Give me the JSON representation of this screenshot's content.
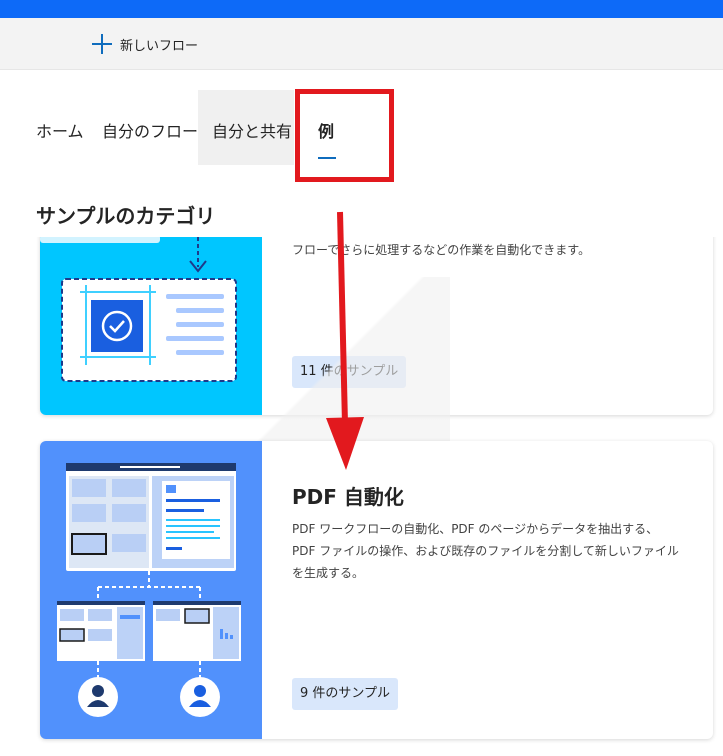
{
  "command_bar": {
    "new_flow_label": "新しいフロー"
  },
  "tabs": [
    {
      "label": "ホーム"
    },
    {
      "label": "自分のフロー"
    },
    {
      "label": "自分と共有"
    },
    {
      "label": "例"
    }
  ],
  "section_title": "サンプルのカテゴリ",
  "cards": [
    {
      "description": "フローでさらに処理するなどの作業を自動化できます。",
      "badge": "11 件のサンプル"
    },
    {
      "title": "PDF 自動化",
      "description": [
        "PDF ワークフローの自動化、PDF のページからデータを抽出する、",
        "PDF ファイルの操作、および既存のファイルを分割して新しいファイル",
        "を生成する。"
      ],
      "badge": "9 件のサンプル"
    }
  ],
  "colors": {
    "brand_blue": "#0d6af8",
    "accent_blue": "#0f6cbd",
    "highlight_red": "#e2191e",
    "card1_illustration": "#00c6ff",
    "card2_illustration": "#5191fc"
  }
}
